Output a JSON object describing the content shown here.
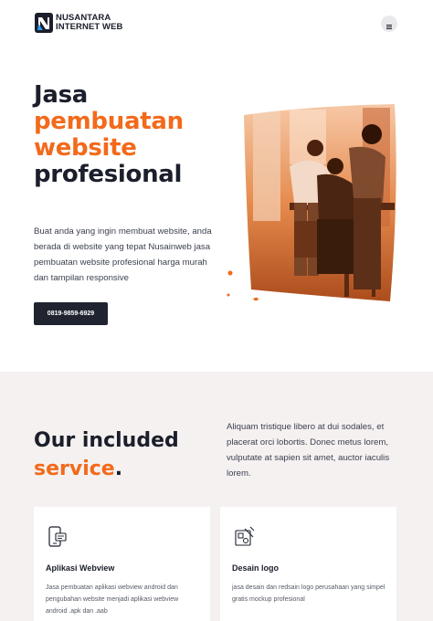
{
  "brand": {
    "line1": "NUSANTARA",
    "line2": "INTERNET WEB",
    "icon": "logo-icon",
    "accent_color": "#f26a1b",
    "dark_color": "#1f2430"
  },
  "header": {
    "menu_icon": "hamburger-icon"
  },
  "hero": {
    "title_line1": "Jasa",
    "title_line2": "pembuatan",
    "title_line3": "website",
    "title_line4": "profesional",
    "description": "Buat anda yang ingin membuat website, anda berada di website yang tepat Nusainweb jasa pembuatan website profesional harga murah dan tampilan responsive",
    "phone_button": "0819-9859-6929"
  },
  "services": {
    "title_line1": "Our included",
    "title_accent": "service",
    "title_dot": ".",
    "description": "Aliquam tristique libero at dui sodales, et placerat orci lobortis. Donec metus lorem, vulputate at sapien sit amet, auctor iaculis lorem.",
    "cards": [
      {
        "icon": "mobile-app-icon",
        "title": "Aplikasi Webview",
        "description": "Jasa pembuatan aplikasi webview android dan pengubahan website menjadi aplikasi webview android .apk dan .aab"
      },
      {
        "icon": "logo-design-icon",
        "title": "Desain logo",
        "description": "jasa desain dan redsain logo perusahaan yang simpel gratis mockup profesional"
      }
    ]
  }
}
